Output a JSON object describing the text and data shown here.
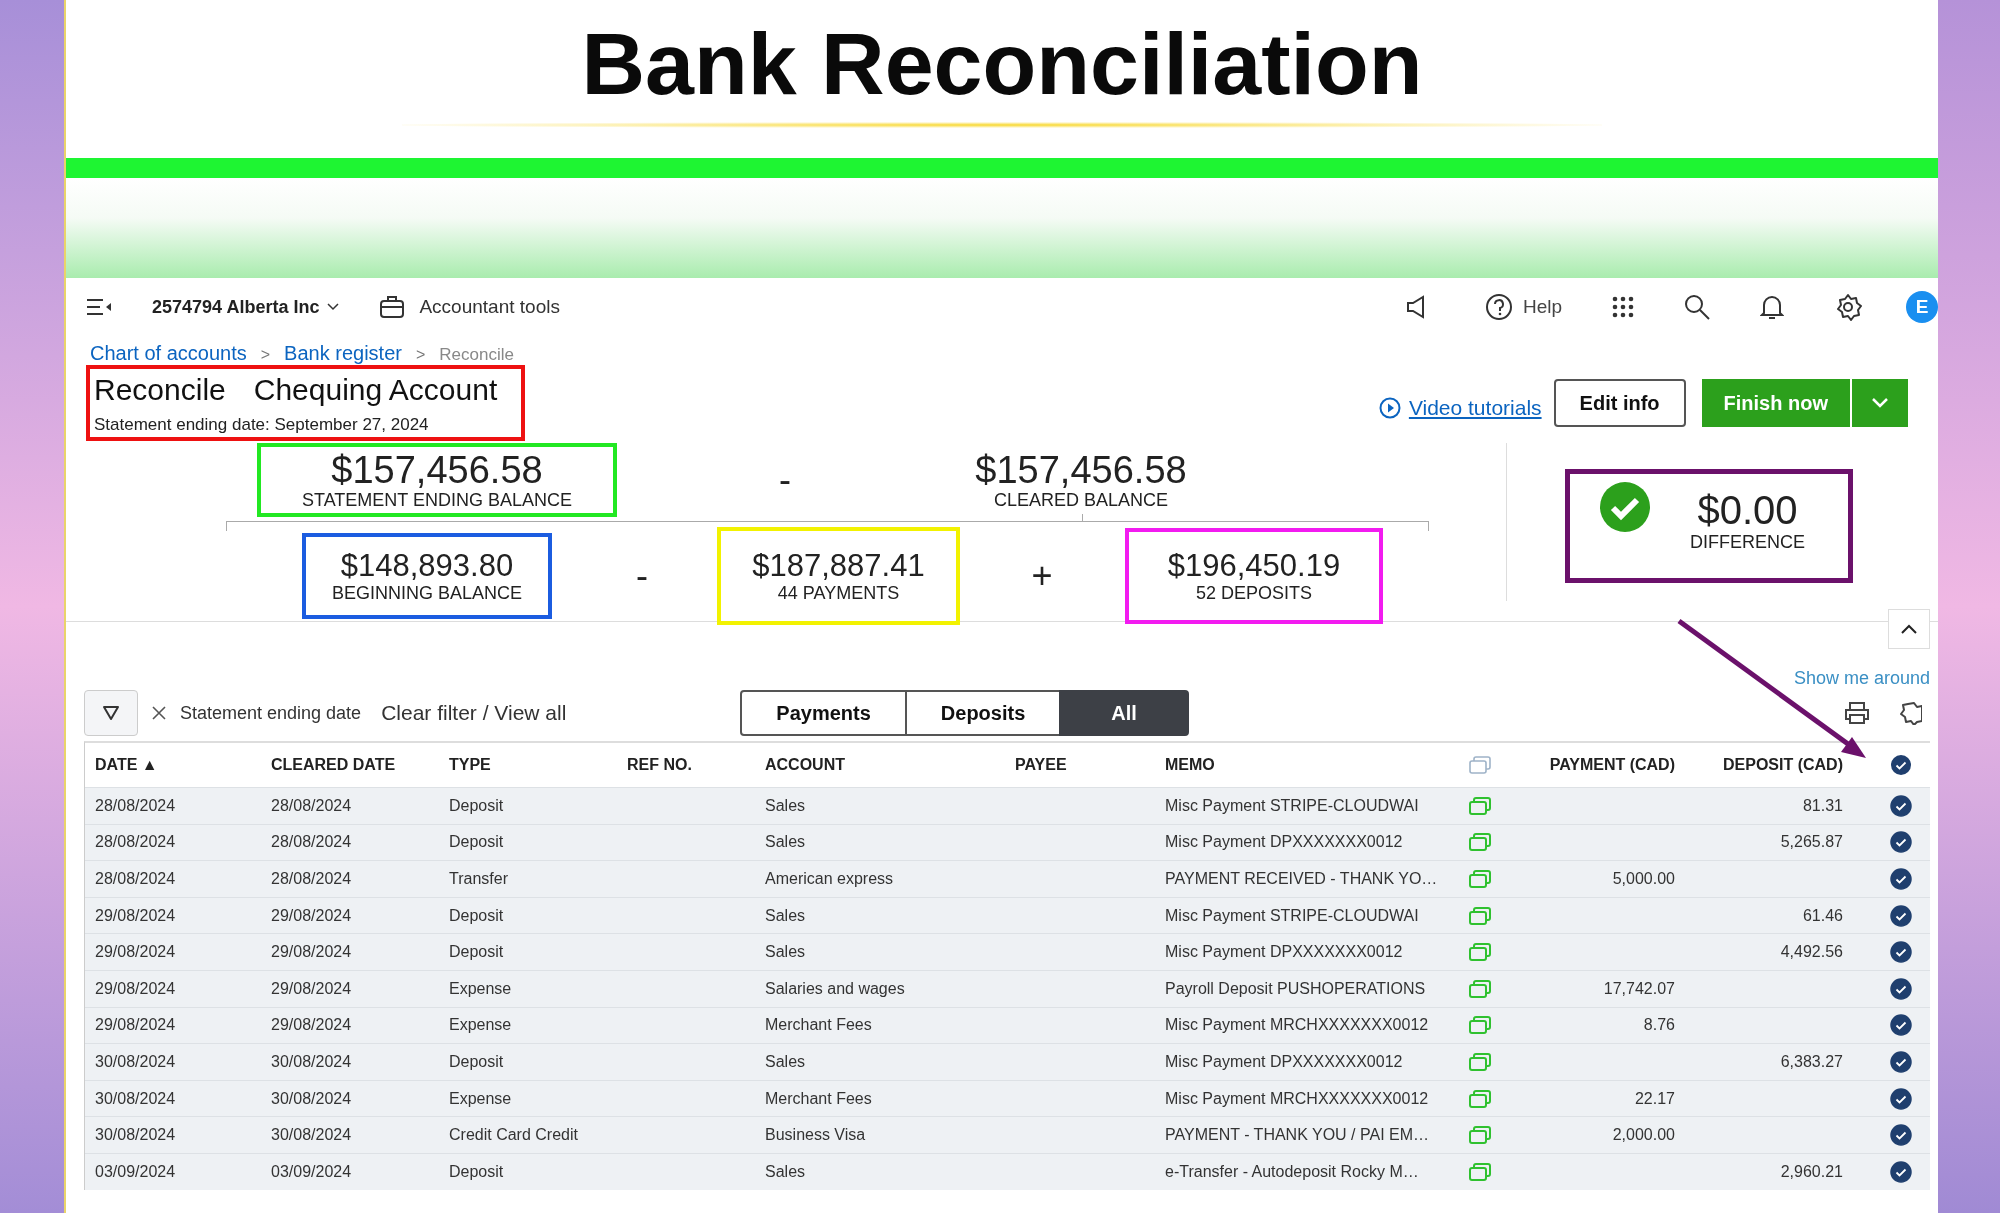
{
  "banner": {
    "title": "Bank Reconciliation"
  },
  "topbar": {
    "company": "2574794 Alberta Inc",
    "accountant_tools": "Accountant tools",
    "help": "Help",
    "avatar": "E"
  },
  "breadcrumb": [
    {
      "label": "Chart of accounts",
      "kind": "link",
      "separator": ">"
    },
    {
      "label": "Bank register",
      "kind": "link",
      "separator": ">"
    },
    {
      "label": "Reconcile",
      "kind": "current"
    }
  ],
  "header": {
    "title": "Reconcile",
    "account": "Chequing Account",
    "date_line": "Statement ending date: September 27, 2024",
    "color": "#ee1111"
  },
  "actions": {
    "video": "Video tutorials",
    "edit": "Edit info",
    "finish": "Finish now"
  },
  "summary": {
    "statement": {
      "amount": "$157,456.58",
      "label": "STATEMENT ENDING BALANCE",
      "color": "#22e822"
    },
    "operator_1": "-",
    "cleared": {
      "amount": "$157,456.58",
      "label": "CLEARED BALANCE"
    },
    "beginning": {
      "amount": "$148,893.80",
      "label": "BEGINNING BALANCE",
      "color": "#1b5ce0"
    },
    "operator_2": "-",
    "payments": {
      "amount": "$187,887.41",
      "label": "44 PAYMENTS",
      "color": "#f2f200"
    },
    "operator_3": "+",
    "deposits": {
      "amount": "$196,450.19",
      "label": "52 DEPOSITS",
      "color": "#f21bf0"
    },
    "difference": {
      "amount": "$0.00",
      "label": "DIFFERENCE",
      "color": "#6b116b"
    }
  },
  "show_me_around": "Show me around",
  "filter": {
    "chip": "Statement ending date",
    "clear": "Clear filter / View all"
  },
  "tabs": [
    {
      "label": "Payments",
      "selected": false
    },
    {
      "label": "Deposits",
      "selected": false
    },
    {
      "label": "All",
      "selected": true
    }
  ],
  "table": {
    "columns": [
      "DATE ▲",
      "CLEARED DATE",
      "TYPE",
      "REF NO.",
      "ACCOUNT",
      "PAYEE",
      "MEMO",
      "PAYMENT (CAD)",
      "DEPOSIT (CAD)"
    ],
    "rows": [
      {
        "date": "28/08/2024",
        "cleared_date": "28/08/2024",
        "type": "Deposit",
        "account": "Sales",
        "memo": "Misc Payment STRIPE-CLOUDWAI",
        "deposit": "81.31",
        "cleared": true
      },
      {
        "date": "28/08/2024",
        "cleared_date": "28/08/2024",
        "type": "Deposit",
        "account": "Sales",
        "memo": "Misc Payment DPXXXXXXX0012",
        "deposit": "5,265.87",
        "cleared": true
      },
      {
        "date": "28/08/2024",
        "cleared_date": "28/08/2024",
        "type": "Transfer",
        "account": "American express",
        "memo": "PAYMENT RECEIVED - THANK YO…",
        "payment": "5,000.00",
        "cleared": true
      },
      {
        "date": "29/08/2024",
        "cleared_date": "29/08/2024",
        "type": "Deposit",
        "account": "Sales",
        "memo": "Misc Payment STRIPE-CLOUDWAI",
        "deposit": "61.46",
        "cleared": true
      },
      {
        "date": "29/08/2024",
        "cleared_date": "29/08/2024",
        "type": "Deposit",
        "account": "Sales",
        "memo": "Misc Payment DPXXXXXXX0012",
        "deposit": "4,492.56",
        "cleared": true
      },
      {
        "date": "29/08/2024",
        "cleared_date": "29/08/2024",
        "type": "Expense",
        "account": "Salaries and wages",
        "memo": "Payroll Deposit PUSHOPERATIONS",
        "payment": "17,742.07",
        "cleared": true
      },
      {
        "date": "29/08/2024",
        "cleared_date": "29/08/2024",
        "type": "Expense",
        "account": "Merchant Fees",
        "memo": "Misc Payment MRCHXXXXXXX0012",
        "payment": "8.76",
        "cleared": true
      },
      {
        "date": "30/08/2024",
        "cleared_date": "30/08/2024",
        "type": "Deposit",
        "account": "Sales",
        "memo": "Misc Payment DPXXXXXXX0012",
        "deposit": "6,383.27",
        "cleared": true
      },
      {
        "date": "30/08/2024",
        "cleared_date": "30/08/2024",
        "type": "Expense",
        "account": "Merchant Fees",
        "memo": "Misc Payment MRCHXXXXXXX0012",
        "payment": "22.17",
        "cleared": true
      },
      {
        "date": "30/08/2024",
        "cleared_date": "30/08/2024",
        "type": "Credit Card Credit",
        "account": "Business Visa",
        "memo": "PAYMENT - THANK YOU / PAI EM…",
        "payment": "2,000.00",
        "cleared": true
      },
      {
        "date": "03/09/2024",
        "cleared_date": "03/09/2024",
        "type": "Deposit",
        "account": "Sales",
        "memo": "e-Transfer - Autodeposit Rocky M…",
        "deposit": "2,960.21",
        "cleared": true
      }
    ]
  }
}
